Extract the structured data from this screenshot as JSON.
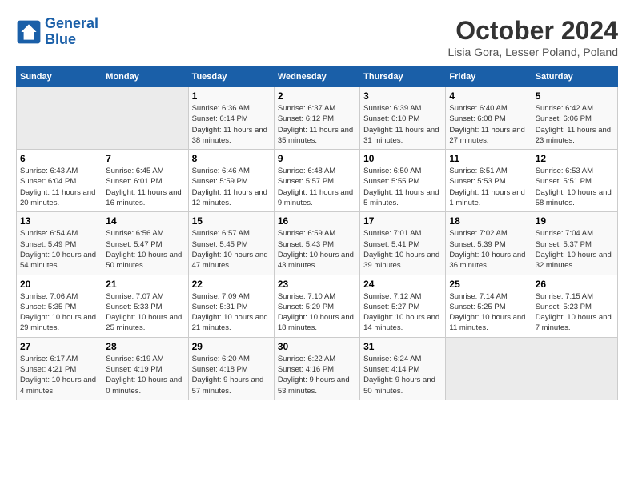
{
  "logo": {
    "line1": "General",
    "line2": "Blue"
  },
  "title": "October 2024",
  "location": "Lisia Gora, Lesser Poland, Poland",
  "days_of_week": [
    "Sunday",
    "Monday",
    "Tuesday",
    "Wednesday",
    "Thursday",
    "Friday",
    "Saturday"
  ],
  "weeks": [
    [
      {
        "day": "",
        "info": ""
      },
      {
        "day": "",
        "info": ""
      },
      {
        "day": "1",
        "info": "Sunrise: 6:36 AM\nSunset: 6:14 PM\nDaylight: 11 hours and 38 minutes."
      },
      {
        "day": "2",
        "info": "Sunrise: 6:37 AM\nSunset: 6:12 PM\nDaylight: 11 hours and 35 minutes."
      },
      {
        "day": "3",
        "info": "Sunrise: 6:39 AM\nSunset: 6:10 PM\nDaylight: 11 hours and 31 minutes."
      },
      {
        "day": "4",
        "info": "Sunrise: 6:40 AM\nSunset: 6:08 PM\nDaylight: 11 hours and 27 minutes."
      },
      {
        "day": "5",
        "info": "Sunrise: 6:42 AM\nSunset: 6:06 PM\nDaylight: 11 hours and 23 minutes."
      }
    ],
    [
      {
        "day": "6",
        "info": "Sunrise: 6:43 AM\nSunset: 6:04 PM\nDaylight: 11 hours and 20 minutes."
      },
      {
        "day": "7",
        "info": "Sunrise: 6:45 AM\nSunset: 6:01 PM\nDaylight: 11 hours and 16 minutes."
      },
      {
        "day": "8",
        "info": "Sunrise: 6:46 AM\nSunset: 5:59 PM\nDaylight: 11 hours and 12 minutes."
      },
      {
        "day": "9",
        "info": "Sunrise: 6:48 AM\nSunset: 5:57 PM\nDaylight: 11 hours and 9 minutes."
      },
      {
        "day": "10",
        "info": "Sunrise: 6:50 AM\nSunset: 5:55 PM\nDaylight: 11 hours and 5 minutes."
      },
      {
        "day": "11",
        "info": "Sunrise: 6:51 AM\nSunset: 5:53 PM\nDaylight: 11 hours and 1 minute."
      },
      {
        "day": "12",
        "info": "Sunrise: 6:53 AM\nSunset: 5:51 PM\nDaylight: 10 hours and 58 minutes."
      }
    ],
    [
      {
        "day": "13",
        "info": "Sunrise: 6:54 AM\nSunset: 5:49 PM\nDaylight: 10 hours and 54 minutes."
      },
      {
        "day": "14",
        "info": "Sunrise: 6:56 AM\nSunset: 5:47 PM\nDaylight: 10 hours and 50 minutes."
      },
      {
        "day": "15",
        "info": "Sunrise: 6:57 AM\nSunset: 5:45 PM\nDaylight: 10 hours and 47 minutes."
      },
      {
        "day": "16",
        "info": "Sunrise: 6:59 AM\nSunset: 5:43 PM\nDaylight: 10 hours and 43 minutes."
      },
      {
        "day": "17",
        "info": "Sunrise: 7:01 AM\nSunset: 5:41 PM\nDaylight: 10 hours and 39 minutes."
      },
      {
        "day": "18",
        "info": "Sunrise: 7:02 AM\nSunset: 5:39 PM\nDaylight: 10 hours and 36 minutes."
      },
      {
        "day": "19",
        "info": "Sunrise: 7:04 AM\nSunset: 5:37 PM\nDaylight: 10 hours and 32 minutes."
      }
    ],
    [
      {
        "day": "20",
        "info": "Sunrise: 7:06 AM\nSunset: 5:35 PM\nDaylight: 10 hours and 29 minutes."
      },
      {
        "day": "21",
        "info": "Sunrise: 7:07 AM\nSunset: 5:33 PM\nDaylight: 10 hours and 25 minutes."
      },
      {
        "day": "22",
        "info": "Sunrise: 7:09 AM\nSunset: 5:31 PM\nDaylight: 10 hours and 21 minutes."
      },
      {
        "day": "23",
        "info": "Sunrise: 7:10 AM\nSunset: 5:29 PM\nDaylight: 10 hours and 18 minutes."
      },
      {
        "day": "24",
        "info": "Sunrise: 7:12 AM\nSunset: 5:27 PM\nDaylight: 10 hours and 14 minutes."
      },
      {
        "day": "25",
        "info": "Sunrise: 7:14 AM\nSunset: 5:25 PM\nDaylight: 10 hours and 11 minutes."
      },
      {
        "day": "26",
        "info": "Sunrise: 7:15 AM\nSunset: 5:23 PM\nDaylight: 10 hours and 7 minutes."
      }
    ],
    [
      {
        "day": "27",
        "info": "Sunrise: 6:17 AM\nSunset: 4:21 PM\nDaylight: 10 hours and 4 minutes."
      },
      {
        "day": "28",
        "info": "Sunrise: 6:19 AM\nSunset: 4:19 PM\nDaylight: 10 hours and 0 minutes."
      },
      {
        "day": "29",
        "info": "Sunrise: 6:20 AM\nSunset: 4:18 PM\nDaylight: 9 hours and 57 minutes."
      },
      {
        "day": "30",
        "info": "Sunrise: 6:22 AM\nSunset: 4:16 PM\nDaylight: 9 hours and 53 minutes."
      },
      {
        "day": "31",
        "info": "Sunrise: 6:24 AM\nSunset: 4:14 PM\nDaylight: 9 hours and 50 minutes."
      },
      {
        "day": "",
        "info": ""
      },
      {
        "day": "",
        "info": ""
      }
    ]
  ]
}
